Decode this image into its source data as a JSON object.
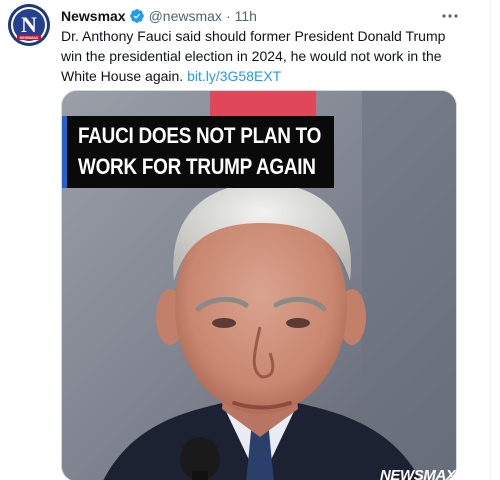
{
  "tweet": {
    "author": {
      "name": "Newsmax",
      "handle": "@newsmax",
      "avatar_text": "NEWSMAX",
      "avatar_letter": "N",
      "verified": true
    },
    "separator": "·",
    "time": "11h",
    "text": "Dr. Anthony Fauci said should former President Donald Trump win the presidential election in 2024, he would not work in the White House again.",
    "link": "bit.ly/3G58EXT",
    "more_icon": "more-horizontal-icon",
    "media": {
      "headline_lines": [
        "FAUCI DOES NOT PLAN TO",
        "WORK FOR TRUMP AGAIN"
      ],
      "watermark": "NEWSMAX"
    }
  },
  "colors": {
    "link": "#1d9bf0",
    "verified": "#1d9bf0",
    "headline_bar": "#1f62d6",
    "avatar_bg": "#1d3a7c"
  }
}
